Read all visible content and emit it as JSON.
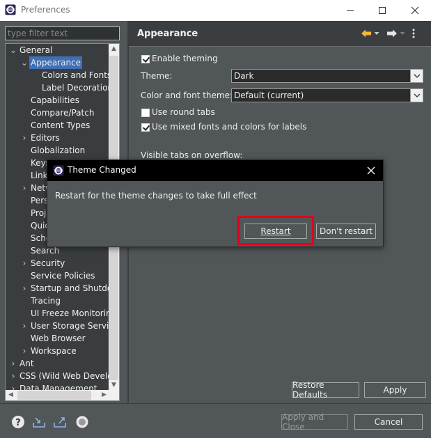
{
  "window": {
    "title": "Preferences",
    "minimize_icon": "minimize-icon",
    "maximize_icon": "maximize-icon",
    "close_icon": "close-icon"
  },
  "filter": {
    "placeholder": "type filter text",
    "value": ""
  },
  "tree": {
    "items": [
      {
        "label": "General",
        "level": 0,
        "expander": "expanded"
      },
      {
        "label": "Appearance",
        "level": 1,
        "expander": "expanded",
        "selected": true
      },
      {
        "label": "Colors and Fonts",
        "level": 2,
        "expander": "none"
      },
      {
        "label": "Label Decorations",
        "level": 2,
        "expander": "none"
      },
      {
        "label": "Capabilities",
        "level": 1,
        "expander": "none"
      },
      {
        "label": "Compare/Patch",
        "level": 1,
        "expander": "none"
      },
      {
        "label": "Content Types",
        "level": 1,
        "expander": "none"
      },
      {
        "label": "Editors",
        "level": 1,
        "expander": "collapsed"
      },
      {
        "label": "Globalization",
        "level": 1,
        "expander": "none"
      },
      {
        "label": "Keys",
        "level": 1,
        "expander": "none"
      },
      {
        "label": "Link",
        "level": 1,
        "expander": "none"
      },
      {
        "label": "Netw",
        "level": 1,
        "expander": "collapsed"
      },
      {
        "label": "Pers",
        "level": 1,
        "expander": "none"
      },
      {
        "label": "Proj",
        "level": 1,
        "expander": "none"
      },
      {
        "label": "Quic",
        "level": 1,
        "expander": "none"
      },
      {
        "label": "Sche",
        "level": 1,
        "expander": "none"
      },
      {
        "label": "Search",
        "level": 1,
        "expander": "none"
      },
      {
        "label": "Security",
        "level": 1,
        "expander": "collapsed"
      },
      {
        "label": "Service Policies",
        "level": 1,
        "expander": "none"
      },
      {
        "label": "Startup and Shutdow",
        "level": 1,
        "expander": "collapsed"
      },
      {
        "label": "Tracing",
        "level": 1,
        "expander": "none"
      },
      {
        "label": "UI Freeze Monitoring",
        "level": 1,
        "expander": "none"
      },
      {
        "label": "User Storage Service",
        "level": 1,
        "expander": "collapsed"
      },
      {
        "label": "Web Browser",
        "level": 1,
        "expander": "none"
      },
      {
        "label": "Workspace",
        "level": 1,
        "expander": "collapsed"
      },
      {
        "label": "Ant",
        "level": 0,
        "expander": "collapsed"
      },
      {
        "label": "CSS (Wild Web Develop",
        "level": 0,
        "expander": "collapsed"
      },
      {
        "label": "Data Management",
        "level": 0,
        "expander": "collapsed"
      }
    ]
  },
  "page": {
    "title": "Appearance",
    "back_icon": "back-arrow-icon",
    "forward_icon": "forward-arrow-icon",
    "menu_icon": "view-menu-icon",
    "enable_theming": {
      "label": "Enable theming",
      "checked": true
    },
    "theme": {
      "label": "Theme:",
      "value": "Dark"
    },
    "color_font_theme": {
      "label": "Color and font theme:",
      "value": "Default (current)"
    },
    "round_tabs": {
      "label": "Use round tabs",
      "checked": false
    },
    "mixed_fonts": {
      "label": "Use mixed fonts and colors for labels",
      "checked": true
    },
    "visible_tabs": {
      "label": "Visible tabs on overflow:"
    },
    "restore_defaults": "Restore Defaults",
    "apply": "Apply"
  },
  "bottom": {
    "help_icon": "help-icon",
    "import_icon": "import-icon",
    "export_icon": "export-icon",
    "record_icon": "record-icon",
    "apply_close": "Apply and Close",
    "cancel": "Cancel"
  },
  "dialog": {
    "title": "Theme Changed",
    "message": "Restart for the theme changes to take full effect",
    "restart": "Restart",
    "dont_restart": "Don't restart",
    "highlight_color": "#e0001a"
  },
  "colors": {
    "background": "#515658",
    "selection": "#3f6fb5",
    "dialog_title": "#000000"
  }
}
